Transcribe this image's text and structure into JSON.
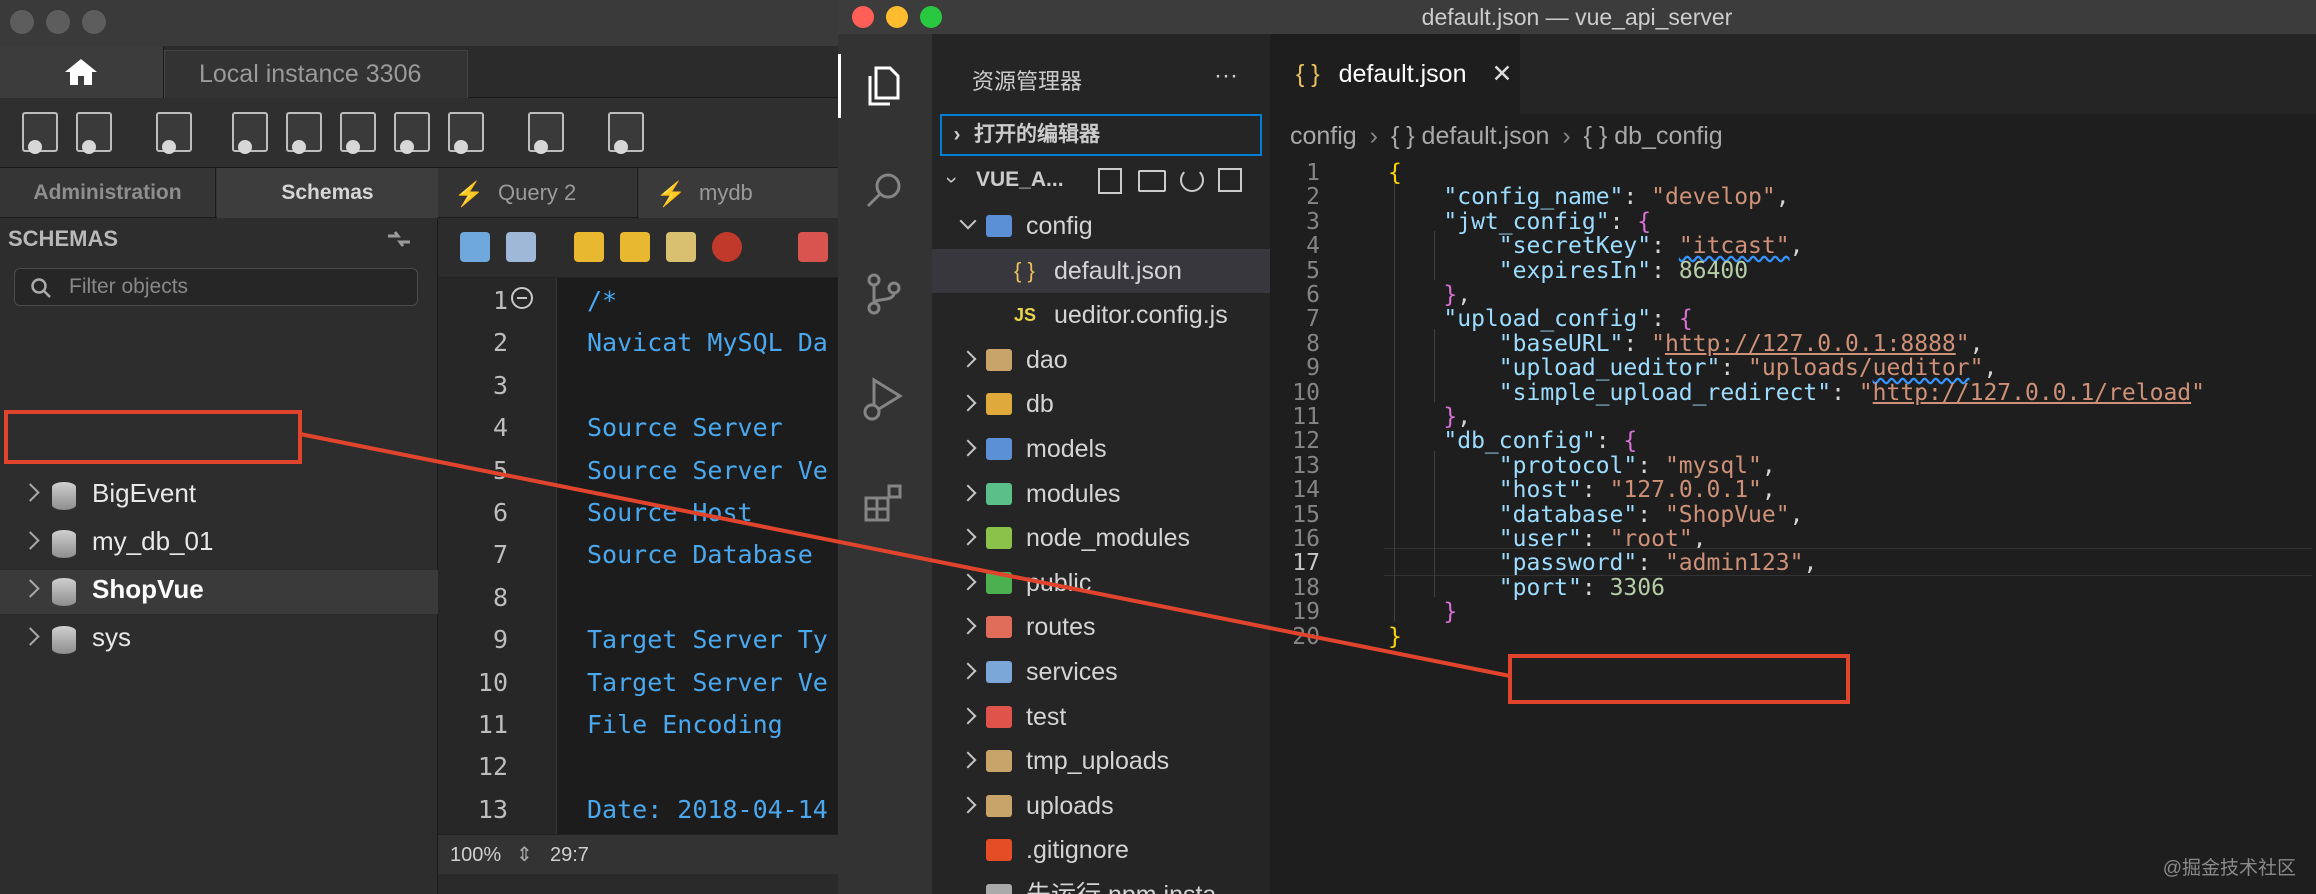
{
  "workbench": {
    "instance_tab": "Local instance 3306",
    "side_tabs": [
      "Administration",
      "Schemas"
    ],
    "schemas_header": "SCHEMAS",
    "filter_placeholder": "Filter objects",
    "schemas": [
      "BigEvent",
      "my_db_01",
      "ShopVue",
      "sys"
    ],
    "selected_schema": "ShopVue",
    "query_tabs": [
      "Query 2",
      "mydb"
    ],
    "sql_lines": [
      {
        "n": "1",
        "t": "/*"
      },
      {
        "n": "2",
        "t": "Navicat MySQL Da"
      },
      {
        "n": "3",
        "t": ""
      },
      {
        "n": "4",
        "t": "Source Server"
      },
      {
        "n": "5",
        "t": "Source Server Ve"
      },
      {
        "n": "6",
        "t": "Source Host"
      },
      {
        "n": "7",
        "t": "Source Database"
      },
      {
        "n": "8",
        "t": ""
      },
      {
        "n": "9",
        "t": "Target Server Ty"
      },
      {
        "n": "10",
        "t": "Target Server Ve"
      },
      {
        "n": "11",
        "t": "File Encoding"
      },
      {
        "n": "12",
        "t": ""
      },
      {
        "n": "13",
        "t": "Date: 2018-04-14"
      }
    ],
    "zoom": "100%",
    "cursor_pos": "29:7"
  },
  "vscode": {
    "window_title": "default.json — vue_api_server",
    "explorer_title": "资源管理器",
    "explorer_more": "···",
    "open_editors": "打开的编辑器",
    "project": "VUE_A...",
    "tree": [
      {
        "label": "config",
        "kind": "folder-open",
        "depth": 0,
        "color": "#5b8fd6"
      },
      {
        "label": "default.json",
        "kind": "json",
        "depth": 1,
        "color": "#e8c15a",
        "selected": true
      },
      {
        "label": "ueditor.config.js",
        "kind": "js",
        "depth": 1,
        "color": "#e8d44d"
      },
      {
        "label": "dao",
        "kind": "folder",
        "depth": 0,
        "color": "#c9a46a"
      },
      {
        "label": "db",
        "kind": "folder",
        "depth": 0,
        "color": "#e0a93c"
      },
      {
        "label": "models",
        "kind": "folder",
        "depth": 0,
        "color": "#5b8fd6"
      },
      {
        "label": "modules",
        "kind": "folder",
        "depth": 0,
        "color": "#5bbf8a"
      },
      {
        "label": "node_modules",
        "kind": "folder",
        "depth": 0,
        "color": "#8bc34a"
      },
      {
        "label": "public",
        "kind": "folder",
        "depth": 0,
        "color": "#4caf50"
      },
      {
        "label": "routes",
        "kind": "folder",
        "depth": 0,
        "color": "#e06c5a"
      },
      {
        "label": "services",
        "kind": "folder",
        "depth": 0,
        "color": "#7aa6d8"
      },
      {
        "label": "test",
        "kind": "folder",
        "depth": 0,
        "color": "#e0534a"
      },
      {
        "label": "tmp_uploads",
        "kind": "folder",
        "depth": 0,
        "color": "#c9a46a"
      },
      {
        "label": "uploads",
        "kind": "folder",
        "depth": 0,
        "color": "#c9a46a"
      },
      {
        "label": ".gitignore",
        "kind": "git",
        "depth": 0,
        "color": "#e44d26"
      },
      {
        "label": "先运行 npm insta...",
        "kind": "file",
        "depth": 0,
        "color": "#aaaaaa"
      }
    ],
    "tab_label": "default.json",
    "tab_icon": "{ }",
    "breadcrumb": [
      "config",
      "{ } default.json",
      "{ } db_config"
    ],
    "current_line": 17,
    "code": [
      [
        [
          "b",
          "{"
        ]
      ],
      [
        [
          "k",
          "    \"config_name\""
        ],
        [
          "p",
          ": "
        ],
        [
          "s",
          "\"develop\""
        ],
        [
          "p",
          ","
        ]
      ],
      [
        [
          "k",
          "    \"jwt_config\""
        ],
        [
          "p",
          ": "
        ],
        [
          "v",
          "{"
        ]
      ],
      [
        [
          "k",
          "        \"secretKey\""
        ],
        [
          "p",
          ": "
        ],
        [
          "sq",
          "\"itcast\""
        ],
        [
          "p",
          ","
        ]
      ],
      [
        [
          "k",
          "        \"expiresIn\""
        ],
        [
          "p",
          ": "
        ],
        [
          "n",
          "86400"
        ]
      ],
      [
        [
          "v",
          "    }"
        ],
        [
          "p",
          ","
        ]
      ],
      [
        [
          "k",
          "    \"upload_config\""
        ],
        [
          "p",
          ": "
        ],
        [
          "v",
          "{"
        ]
      ],
      [
        [
          "k",
          "        \"baseURL\""
        ],
        [
          "p",
          ": "
        ],
        [
          "s",
          "\""
        ],
        [
          "u",
          "http://127.0.0.1:8888"
        ],
        [
          "s",
          "\""
        ],
        [
          "p",
          ","
        ]
      ],
      [
        [
          "k",
          "        \"upload_ueditor\""
        ],
        [
          "p",
          ": "
        ],
        [
          "s",
          "\"uploads/"
        ],
        [
          "sq",
          "ueditor"
        ],
        [
          "s",
          "\""
        ],
        [
          "p",
          ","
        ]
      ],
      [
        [
          "k",
          "        \"simple_upload_redirect\""
        ],
        [
          "p",
          ": "
        ],
        [
          "s",
          "\""
        ],
        [
          "u",
          "http://127.0.0.1/reload"
        ],
        [
          "s",
          "\""
        ]
      ],
      [
        [
          "v",
          "    }"
        ],
        [
          "p",
          ","
        ]
      ],
      [
        [
          "k",
          "    \"db_config\""
        ],
        [
          "p",
          ": "
        ],
        [
          "v",
          "{"
        ]
      ],
      [
        [
          "k",
          "        \"protocol\""
        ],
        [
          "p",
          ": "
        ],
        [
          "s",
          "\"mysql\""
        ],
        [
          "p",
          ","
        ]
      ],
      [
        [
          "k",
          "        \"host\""
        ],
        [
          "p",
          ": "
        ],
        [
          "s",
          "\"127.0.0.1\""
        ],
        [
          "p",
          ","
        ]
      ],
      [
        [
          "k",
          "        \"database\""
        ],
        [
          "p",
          ": "
        ],
        [
          "s",
          "\"ShopVue\""
        ],
        [
          "p",
          ","
        ]
      ],
      [
        [
          "k",
          "        \"user\""
        ],
        [
          "p",
          ": "
        ],
        [
          "s",
          "\"root\""
        ],
        [
          "p",
          ","
        ]
      ],
      [
        [
          "k",
          "        \"password\""
        ],
        [
          "p",
          ": "
        ],
        [
          "s",
          "\"admin123\""
        ],
        [
          "p",
          ","
        ]
      ],
      [
        [
          "k",
          "        \"port\""
        ],
        [
          "p",
          ": "
        ],
        [
          "n",
          "3306"
        ]
      ],
      [
        [
          "v",
          "    }"
        ]
      ],
      [
        [
          "b",
          "}"
        ]
      ]
    ]
  },
  "watermark": "@掘金技术社区",
  "colors": {
    "annotation": "#e0442c",
    "vs_bg": "#1e1e1e",
    "wb_bg": "#2a2a2a"
  }
}
